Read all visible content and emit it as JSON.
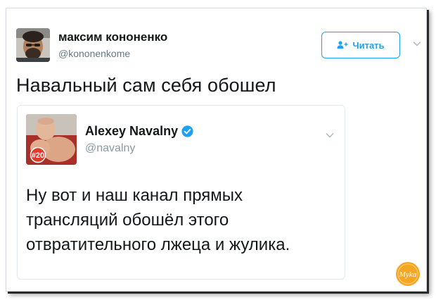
{
  "author": {
    "name": "максим кононенко",
    "handle": "@kononenkome"
  },
  "follow_button": {
    "label": "Читать",
    "icon": "add-person-icon"
  },
  "tweet": {
    "text": "Навальный сам себя обошел"
  },
  "quoted_tweet": {
    "author_name": "Alexey Navalny",
    "author_handle": "@navalny",
    "verified": true,
    "avatar_badge": "#20",
    "text_lines": [
      "Ну вот и наш канал прямых",
      "трансляций обошёл этого",
      "отвратительного лжеца и жулика."
    ]
  },
  "watermark": {
    "text": "Myka"
  },
  "colors": {
    "accent": "#1da1f2",
    "text": "#14171a",
    "muted": "#657786",
    "watermark": "#f5a623"
  }
}
